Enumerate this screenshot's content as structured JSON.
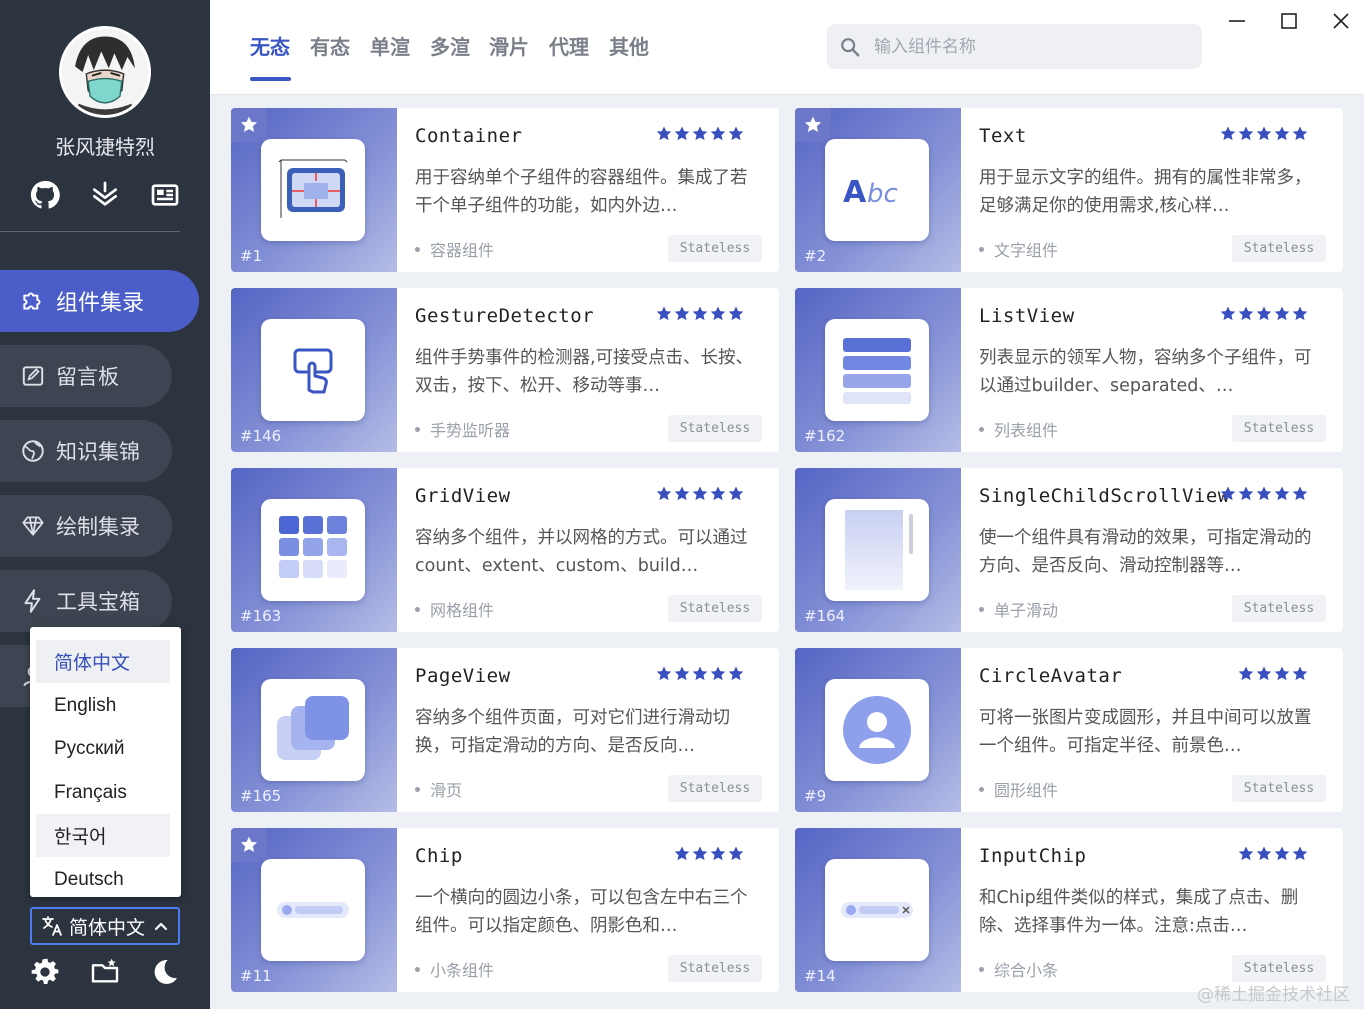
{
  "user": {
    "name": "张风捷特烈"
  },
  "nav": [
    {
      "label": "组件集录",
      "icon": "puzzle-icon",
      "active": true
    },
    {
      "label": "留言板",
      "icon": "edit-board-icon"
    },
    {
      "label": "知识集锦",
      "icon": "globe-icon"
    },
    {
      "label": "绘制集录",
      "icon": "diamond-icon"
    },
    {
      "label": "工具宝箱",
      "icon": "lightning-icon"
    }
  ],
  "language_menu": {
    "options": [
      "简体中文",
      "English",
      "Русский",
      "Français",
      "한국어",
      "Deutsch"
    ],
    "selected": "简体中文",
    "button_label": "简体中文"
  },
  "tabs": [
    "无态",
    "有态",
    "单渲",
    "多渲",
    "滑片",
    "代理",
    "其他"
  ],
  "active_tab": "无态",
  "search": {
    "placeholder": "输入组件名称"
  },
  "cards": [
    {
      "title": "Container",
      "stars": 5,
      "desc": "用于容纳单个子组件的容器组件。集成了若干个单子组件的功能，如内外边…",
      "category": "容器组件",
      "badge": "Stateless",
      "index": "#1",
      "favorite": true,
      "thumb_icon": "container-icon"
    },
    {
      "title": "Text",
      "stars": 5,
      "desc": "用于显示文字的组件。拥有的属性非常多，足够满足你的使用需求,核心样…",
      "category": "文字组件",
      "badge": "Stateless",
      "index": "#2",
      "favorite": true,
      "thumb_icon": "text-abc-icon",
      "thumb_text": "Abc"
    },
    {
      "title": "GestureDetector",
      "stars": 5,
      "desc": "组件手势事件的检测器,可接受点击、长按、双击，按下、松开、移动等事…",
      "category": "手势监听器",
      "badge": "Stateless",
      "index": "#146",
      "favorite": false,
      "thumb_icon": "touch-icon"
    },
    {
      "title": "ListView",
      "stars": 5,
      "desc": "列表显示的领军人物，容纳多个子组件，可以通过builder、separated、…",
      "category": "列表组件",
      "badge": "Stateless",
      "index": "#162",
      "favorite": false,
      "thumb_icon": "list-icon"
    },
    {
      "title": "GridView",
      "stars": 5,
      "desc": "容纳多个组件，并以网格的方式。可以通过count、extent、custom、build…",
      "category": "网格组件",
      "badge": "Stateless",
      "index": "#163",
      "favorite": false,
      "thumb_icon": "grid-icon"
    },
    {
      "title": "SingleChildScrollView",
      "stars": 5,
      "desc": "使一个组件具有滑动的效果，可指定滑动的方向、是否反向、滑动控制器等…",
      "category": "单子滑动",
      "badge": "Stateless",
      "index": "#164",
      "favorite": false,
      "thumb_icon": "scroll-icon"
    },
    {
      "title": "PageView",
      "stars": 5,
      "desc": "容纳多个组件页面，可对它们进行滑动切换，可指定滑动的方向、是否反向…",
      "category": "滑页",
      "badge": "Stateless",
      "index": "#165",
      "favorite": false,
      "thumb_icon": "pages-icon"
    },
    {
      "title": "CircleAvatar",
      "stars": 4,
      "desc": "可将一张图片变成圆形，并且中间可以放置一个组件。可指定半径、前景色…",
      "category": "圆形组件",
      "badge": "Stateless",
      "index": "#9",
      "favorite": false,
      "thumb_icon": "avatar-icon"
    },
    {
      "title": "Chip",
      "stars": 4,
      "desc": "一个横向的圆边小条，可以包含左中右三个组件。可以指定颜色、阴影色和…",
      "category": "小条组件",
      "badge": "Stateless",
      "index": "#11",
      "favorite": true,
      "thumb_icon": "chip-icon"
    },
    {
      "title": "InputChip",
      "stars": 4,
      "desc": "和Chip组件类似的样式，集成了点击、删除、选择事件为一体。注意:点击…",
      "category": "综合小条",
      "badge": "Stateless",
      "index": "#14",
      "favorite": false,
      "thumb_icon": "input-chip-icon"
    }
  ],
  "watermark": "@稀土掘金技术社区",
  "colors": {
    "accent": "#3a55c4",
    "sidebar": "#2c3440",
    "nav_active": "#4b5dc9",
    "star": "#3a4fbf"
  }
}
